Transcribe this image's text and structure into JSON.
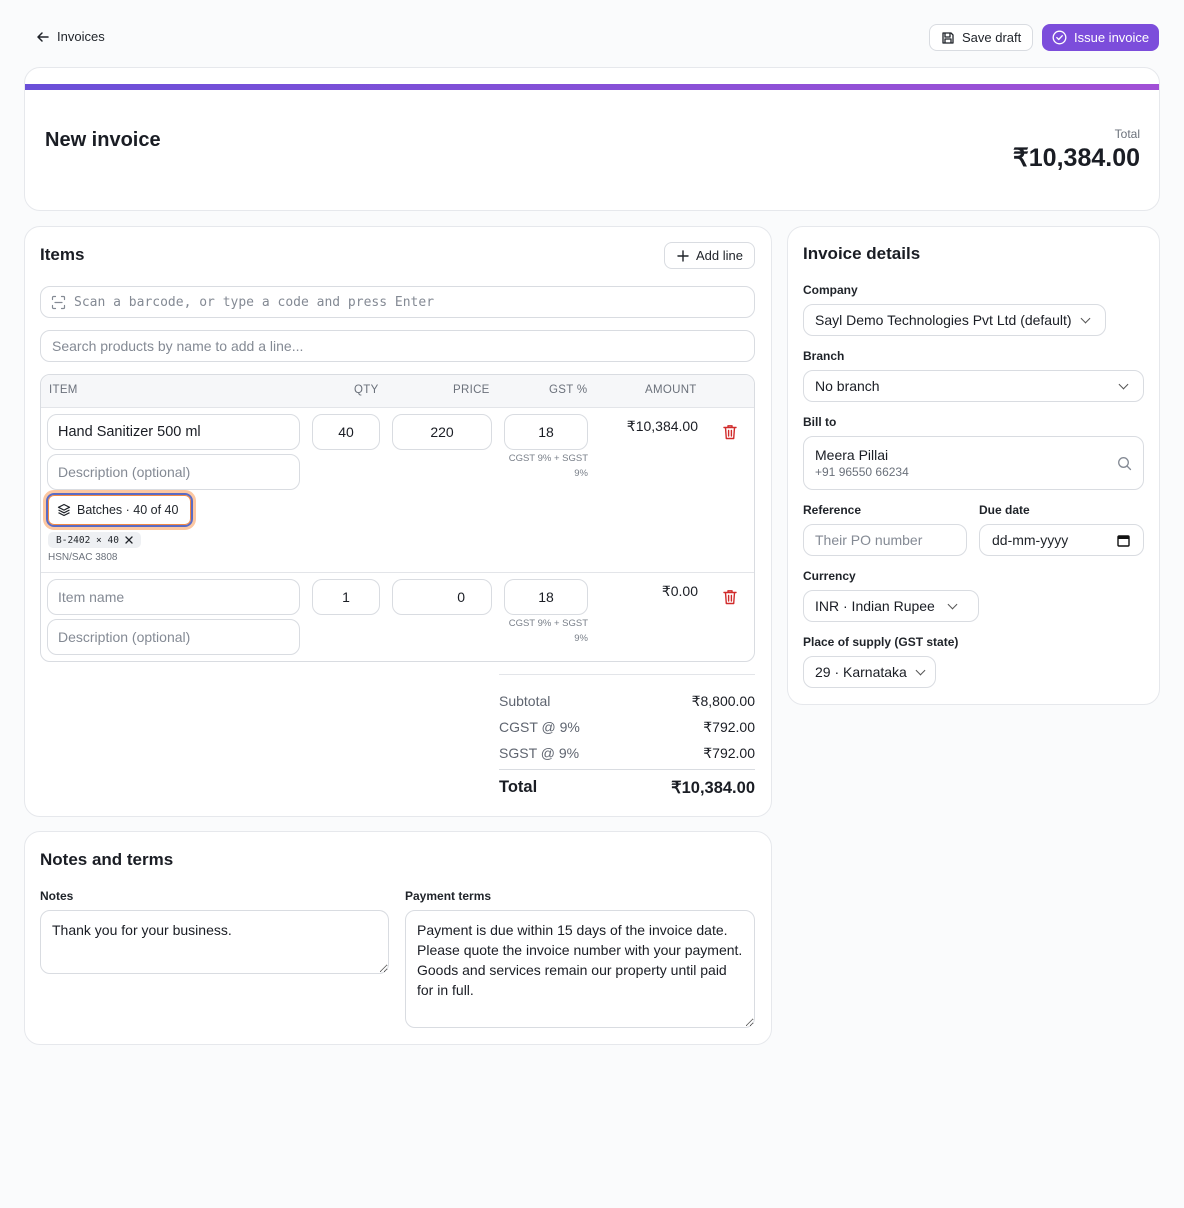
{
  "header": {
    "back_label": "Invoices",
    "save_draft_label": "Save draft",
    "issue_invoice_label": "Issue invoice"
  },
  "hero": {
    "title": "New invoice",
    "total_label": "Total",
    "total_value": "₹10,384.00",
    "accent_gradient": [
      "#6a4fd8",
      "#a150d6"
    ]
  },
  "items": {
    "heading": "Items",
    "add_line_label": "Add line",
    "scan_placeholder": "Scan a barcode, or type a code and press Enter",
    "search_placeholder": "Search products by name to add a line...",
    "columns": [
      "ITEM",
      "QTY",
      "PRICE",
      "GST %",
      "AMOUNT"
    ],
    "lines": [
      {
        "name": "Hand Sanitizer 500 ml",
        "description_placeholder": "Description (optional)",
        "qty": "40",
        "price": "220",
        "gst": "18",
        "tax_note": "CGST 9% + SGST 9%",
        "amount": "₹10,384.00",
        "batches_label": "Batches · 40 of 40",
        "batch_chip": "B-2402 × 40",
        "hsn": "HSN/SAC 3808"
      },
      {
        "name_placeholder": "Item name",
        "description_placeholder": "Description (optional)",
        "qty": "1",
        "price": "0",
        "gst": "18",
        "tax_note": "CGST 9% + SGST 9%",
        "amount": "₹0.00"
      }
    ],
    "summary": {
      "subtotal_label": "Subtotal",
      "subtotal_value": "₹8,800.00",
      "cgst_label": "CGST @ 9%",
      "cgst_value": "₹792.00",
      "sgst_label": "SGST @ 9%",
      "sgst_value": "₹792.00",
      "total_label": "Total",
      "total_value": "₹10,384.00"
    }
  },
  "details": {
    "heading": "Invoice details",
    "company_label": "Company",
    "company_value": "Sayl Demo Technologies Pvt Ltd (default)",
    "branch_label": "Branch",
    "branch_value": "No branch",
    "bill_to_label": "Bill to",
    "bill_to_name": "Meera Pillai",
    "bill_to_phone": "+91 96550 66234",
    "reference_label": "Reference",
    "reference_placeholder": "Their PO number",
    "due_date_label": "Due date",
    "due_date_placeholder": "dd-mm-yyyy",
    "currency_label": "Currency",
    "currency_value": "INR · Indian Rupee",
    "place_label": "Place of supply (GST state)",
    "place_value": "29 · Karnataka"
  },
  "notes": {
    "heading": "Notes and terms",
    "notes_label": "Notes",
    "notes_value": "Thank you for your business.",
    "terms_label": "Payment terms",
    "terms_value": "Payment is due within 15 days of the invoice date. Please quote the invoice number with your payment.\nGoods and services remain our property until paid for in full."
  },
  "colors": {
    "accent": "#7c4ddb",
    "danger": "#d12b2b",
    "focus_ring": "#f28a45"
  },
  "icons": [
    "arrow-left-icon",
    "save-icon",
    "check-circle-icon",
    "plus-icon",
    "scan-icon",
    "layers-icon",
    "close-icon",
    "trash-icon",
    "search-icon",
    "chevron-down-icon",
    "calendar-icon"
  ]
}
